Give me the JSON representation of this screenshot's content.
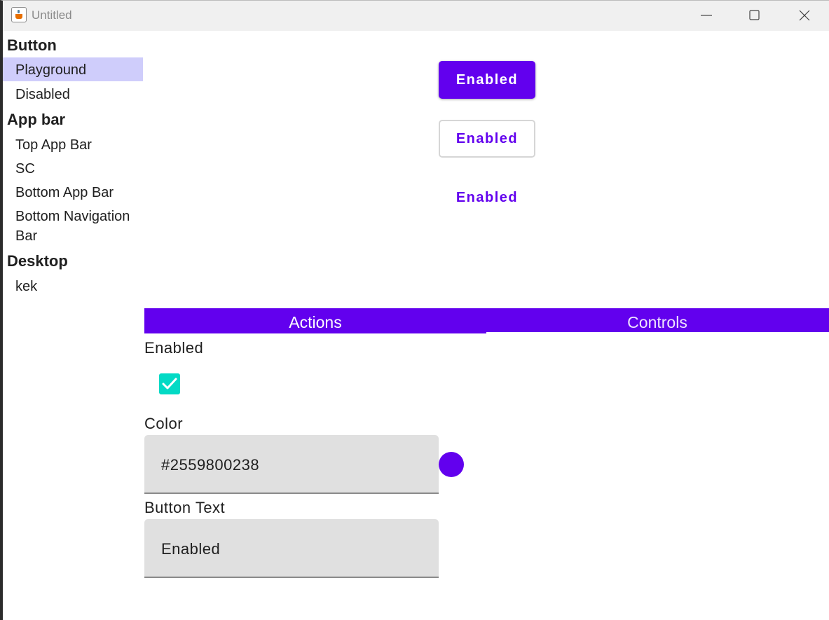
{
  "window": {
    "title": "Untitled",
    "icon": "java-cup-icon"
  },
  "sidebar": {
    "groups": [
      {
        "title": "Button",
        "items": [
          "Playground",
          "Disabled"
        ]
      },
      {
        "title": "App bar",
        "items": [
          "Top App Bar",
          "SC",
          "Bottom App Bar",
          "Bottom Navigation Bar"
        ]
      },
      {
        "title": "Desktop",
        "items": [
          "kek"
        ]
      }
    ],
    "selected_item": "Playground",
    "bottom_navigation_line1": "Bottom Navigation",
    "bottom_navigation_line2": "Bar"
  },
  "preview": {
    "contained_label": "Enabled",
    "outlined_label": "Enabled",
    "text_label": "Enabled"
  },
  "tabs": {
    "items": [
      "Actions",
      "Controls"
    ],
    "selected": "Controls"
  },
  "controls": {
    "enabled_label": "Enabled",
    "enabled_checked": true,
    "color_label": "Color",
    "color_value": "#2559800238",
    "button_text_label": "Button Text",
    "button_text_value": "Enabled"
  },
  "colors": {
    "primary": "#6200ee",
    "checkbox": "#03dac5",
    "selection": "#cfcdfb",
    "field_bg": "#e0e0e0"
  }
}
